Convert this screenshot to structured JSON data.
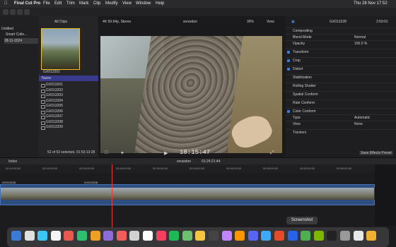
{
  "menubar": {
    "app": "Final Cut Pro",
    "items": [
      "File",
      "Edit",
      "Trim",
      "Mark",
      "Clip",
      "Modify",
      "View",
      "Window",
      "Help"
    ],
    "datetime": "Thu 28 Nov 17:52"
  },
  "library": {
    "items": [
      {
        "label": "Untitled"
      },
      {
        "label": "Smart Colle..."
      },
      {
        "label": "28-11-2024"
      }
    ]
  },
  "browser": {
    "filter": "All Clips",
    "thumb_label": "GX013201",
    "column_header": "Name",
    "clips": [
      "GX013201",
      "GX013202",
      "GX013203",
      "GX013204",
      "GX013205",
      "GX013206",
      "GX013207",
      "GX013208",
      "GX013209"
    ],
    "status": "52 of 53 selected, 01:53:13:28"
  },
  "viewer": {
    "format": "4K 59.94p, Stereo",
    "project": "snowdon",
    "zoom": "35%",
    "view": "View",
    "timecode": "18:15:47"
  },
  "inspector": {
    "clip_name": "GX013228",
    "duration": "2:59:01",
    "section_title": "Compositing",
    "blend_mode_label": "Blend Mode",
    "blend_mode_value": "Normal",
    "opacity_label": "Opacity",
    "opacity_value": "100.0 %",
    "rows": [
      "Transform",
      "Crop",
      "Distort",
      "Stabilization",
      "Rolling Shutter",
      "Spatial Conform",
      "Rate Conform",
      "Color Conform"
    ],
    "type_label": "Type",
    "type_value": "Automatic",
    "view_label": "View",
    "view_value": "None",
    "trackers_label": "Trackers",
    "save_preset": "Save Effects Preset"
  },
  "timeline": {
    "index_label": "Index",
    "project": "snowdon",
    "duration": "01:24:21:44",
    "ruler": [
      "00:10:00:00",
      "00:15:00:00",
      "00:20:00:00",
      "00:25:00:00",
      "00:30:00:00",
      "00:35:00:00",
      "00:40:00:00",
      "00:45:00:00",
      "00:50:00:00",
      "00:55:00:00"
    ],
    "clip_label_a": "GX013226",
    "clip_label_b": "GX013228"
  },
  "dock": {
    "tooltip": "Screenshot",
    "colors": [
      "#3a7bd5",
      "#e0e0e0",
      "#3cc6f5",
      "#f4f4f4",
      "#e85a4f",
      "#2fbf71",
      "#f0a020",
      "#8f6bd8",
      "#f05d5d",
      "#d1d1d1",
      "#ffffff",
      "#f43f5e",
      "#1db954",
      "#6cc070",
      "#f5c542",
      "#444444",
      "#c084fc",
      "#ff9500",
      "#5865f2",
      "#3fa9f5",
      "#e34c26",
      "#2563eb",
      "#4caf50",
      "#7fb800",
      "#222222",
      "#999999",
      "#e8e8e8",
      "#f0b030"
    ]
  }
}
